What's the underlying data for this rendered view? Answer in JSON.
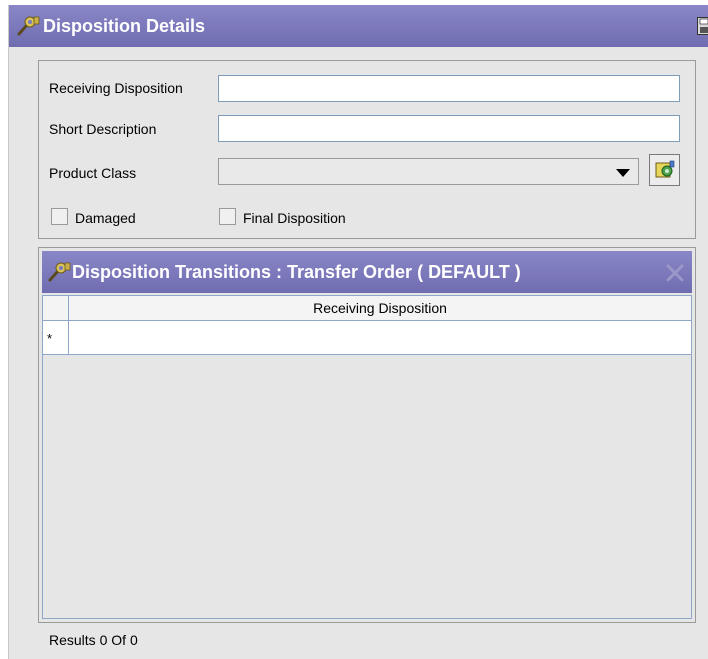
{
  "header": {
    "title": "Disposition Details",
    "icon": "wrench-gear-icon",
    "save_icon": "floppy-save-icon"
  },
  "form": {
    "receiving_disposition": {
      "label": "Receiving Disposition",
      "value": ""
    },
    "short_description": {
      "label": "Short Description",
      "value": ""
    },
    "product_class": {
      "label": "Product Class",
      "value": ""
    },
    "lookup_icon": "lookup-icon",
    "damaged": {
      "label": "Damaged",
      "checked": false
    },
    "final_disposition": {
      "label": "Final Disposition",
      "checked": false
    }
  },
  "transitions": {
    "title": "Disposition Transitions : Transfer Order ( DEFAULT )",
    "close_icon": "close-icon",
    "columns": [
      "Receiving Disposition"
    ],
    "new_row_marker": "*",
    "rows": [],
    "results_label": "Results",
    "results_count": "0",
    "results_of": "Of",
    "results_total": "0"
  },
  "colors": {
    "titlebar": "#7b78bd",
    "panel_bg": "#e6e6e6",
    "grid_border": "#8fa6c8"
  }
}
